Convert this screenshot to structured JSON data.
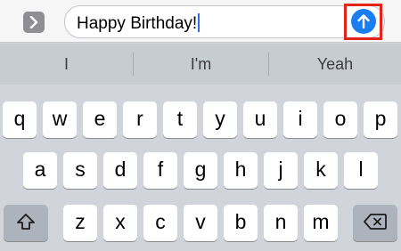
{
  "compose": {
    "message_text": "Happy Birthday!",
    "send_color": "#1a7df2",
    "highlight_color": "#e3241b"
  },
  "predictions": [
    "I",
    "I'm",
    "Yeah"
  ],
  "keyboard": {
    "row1": [
      "q",
      "w",
      "e",
      "r",
      "t",
      "y",
      "u",
      "i",
      "o",
      "p"
    ],
    "row2": [
      "a",
      "s",
      "d",
      "f",
      "g",
      "h",
      "j",
      "k",
      "l"
    ],
    "row3": [
      "z",
      "x",
      "c",
      "v",
      "b",
      "n",
      "m"
    ]
  },
  "icons": {
    "expand": "chevron-right-icon",
    "send": "arrow-up-icon",
    "shift": "shift-arrow-icon",
    "delete": "backspace-icon"
  }
}
